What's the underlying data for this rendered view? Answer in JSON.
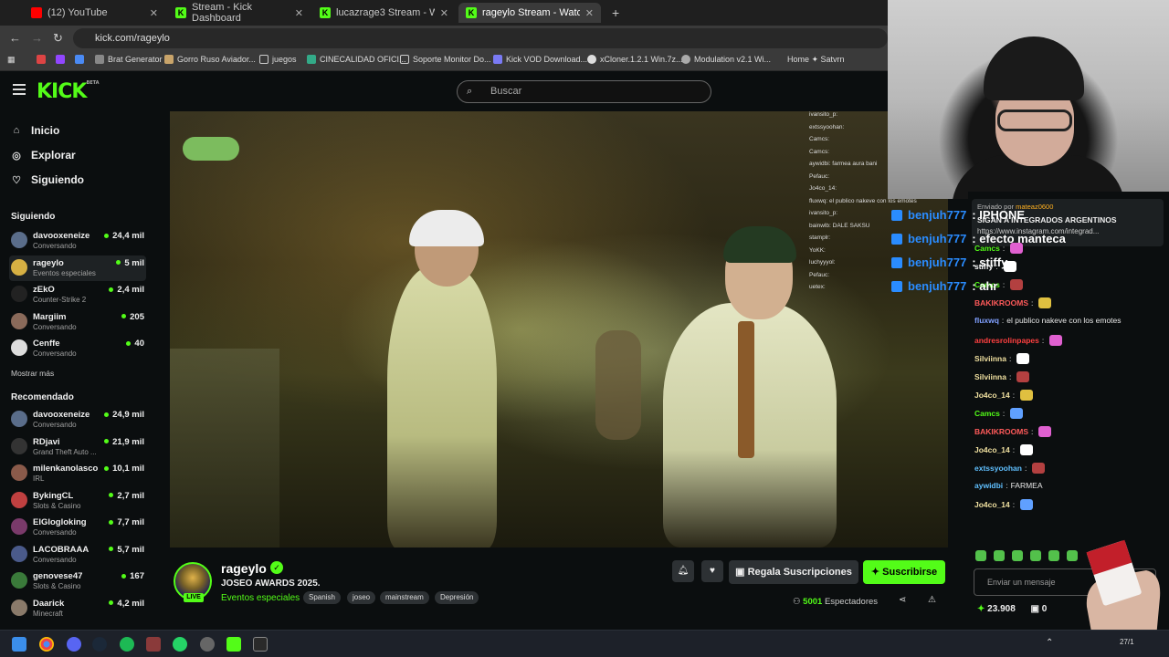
{
  "browser": {
    "tabs": [
      {
        "label": "(12) YouTube",
        "color": "#ff0000",
        "active": false
      },
      {
        "label": "Stream - Kick Dashboard",
        "color": "#53fc18",
        "active": false
      },
      {
        "label": "lucazrage3 Stream - Watch Live",
        "color": "#53fc18",
        "active": false
      },
      {
        "label": "rageylo Stream - Watch Live",
        "color": "#53fc18",
        "active": true
      }
    ],
    "url": "kick.com/rageylo",
    "bookmarks": [
      "Brat Generator",
      "Gorro Ruso Aviador...",
      "juegos",
      "CINECALIDAD OFICI...",
      "Soporte Monitor Do...",
      "Kick VOD Download...",
      "xCloner.1.2.1 Win.7z...",
      "Modulation v2.1 Wi...",
      "Home ✦ Satvrn"
    ]
  },
  "header": {
    "logo": "KICK",
    "logo_sup": "BETA",
    "search_placeholder": "Buscar"
  },
  "sidebar": {
    "nav": [
      {
        "label": "Inicio",
        "icon": "home-icon",
        "glyph": "⌂"
      },
      {
        "label": "Explorar",
        "icon": "compass-icon",
        "glyph": "◎"
      },
      {
        "label": "Siguiendo",
        "icon": "heart-icon",
        "glyph": "♡"
      }
    ],
    "following_title": "Siguiendo",
    "following": [
      {
        "name": "davooxeneize",
        "category": "Conversando",
        "viewers": "24,4 mil",
        "color": "#5a6d8a"
      },
      {
        "name": "rageylo",
        "category": "Eventos especiales",
        "viewers": "5 mil",
        "color": "#d6b043"
      },
      {
        "name": "zEkO",
        "category": "Counter-Strike 2",
        "viewers": "2,4 mil",
        "color": "#222222"
      },
      {
        "name": "Margiim",
        "category": "Conversando",
        "viewers": "205",
        "color": "#8a6a5a"
      },
      {
        "name": "Cenffe",
        "category": "Conversando",
        "viewers": "40",
        "color": "#dddddd"
      }
    ],
    "show_more": "Mostrar más",
    "recommended_title": "Recomendado",
    "recommended": [
      {
        "name": "davooxeneize",
        "category": "Conversando",
        "viewers": "24,9 mil",
        "color": "#5a6d8a"
      },
      {
        "name": "RDjavi",
        "category": "Grand Theft Auto ...",
        "viewers": "21,9 mil",
        "color": "#333333"
      },
      {
        "name": "milenkanolasco",
        "category": "IRL",
        "viewers": "10,1 mil",
        "color": "#8a5a4a"
      },
      {
        "name": "BykingCL",
        "category": "Slots & Casino",
        "viewers": "2,7 mil",
        "color": "#c04040"
      },
      {
        "name": "ElGlogloking",
        "category": "Conversando",
        "viewers": "7,7 mil",
        "color": "#7a3a6a"
      },
      {
        "name": "LACOBRAAA",
        "category": "Conversando",
        "viewers": "5,7 mil",
        "color": "#4a5a8a"
      },
      {
        "name": "genovese47",
        "category": "Slots & Casino",
        "viewers": "167",
        "color": "#3a7a3a"
      },
      {
        "name": "Daarick",
        "category": "Minecraft",
        "viewers": "4,2 mil",
        "color": "#8a7a6a"
      }
    ]
  },
  "stream": {
    "name": "rageylo",
    "title": "JOSEO AWARDS 2025.",
    "category": "Eventos especiales",
    "tags": [
      "Spanish",
      "joseo",
      "mainstream",
      "Depresión"
    ],
    "live": "LIVE",
    "gift_label": "Regala Suscripciones",
    "subscribe_label": "Suscribirse",
    "viewers": "5001",
    "viewers_label": "Espectadores"
  },
  "overlay_alerts": [
    {
      "user": "benjuh777",
      "text": ": IPHONE"
    },
    {
      "user": "benjuh777",
      "text": ": efecto manteca"
    },
    {
      "user": "benjuh777",
      "text": ": stiffy"
    },
    {
      "user": "benjuh777",
      "text": ": ahr"
    }
  ],
  "video_chat": [
    "ivansito_p:",
    "extssyoohan:",
    "Camcs:",
    "Camcs:",
    "aywidbi: farmea aura bani",
    "Pefauc:",
    "Jo4co_14:",
    "fluxwq: el publico nakeve con los emotes",
    "ivansito_p:",
    "bainwlb: DALE SAKSU",
    "stamplr:",
    "YoKK:",
    "luchyyyol:",
    "Pefauc:",
    "uetex:"
  ],
  "chat": {
    "pinned_by": "Enviado por",
    "pinned_user": "mateaz0600",
    "pinned_text1": "SIGAN A INTEGRADOS ARGENTINOS",
    "pinned_text2": "https://www.instagram.com/integrad...",
    "messages": [
      {
        "user": "Camcs",
        "text": "",
        "color": "#53fc18"
      },
      {
        "user": "stiffy",
        "text": "",
        "color": "#ffffff"
      },
      {
        "user": "Camcs",
        "text": "",
        "color": "#53fc18"
      },
      {
        "user": "BAKIKROOMS",
        "text": "",
        "color": "#ff5a5a"
      },
      {
        "user": "fluxwq",
        "text": "el publico nakeve con los emotes",
        "color": "#80a0ff"
      },
      {
        "user": "andresrolinpapes",
        "text": "",
        "color": "#ff4040"
      },
      {
        "user": "Silviinna",
        "text": "",
        "color": "#f0e0a0"
      },
      {
        "user": "Silviinna",
        "text": "",
        "color": "#f0e0a0"
      },
      {
        "user": "Jo4co_14",
        "text": "",
        "color": "#f0e0a0"
      },
      {
        "user": "Camcs",
        "text": "",
        "color": "#53fc18"
      },
      {
        "user": "BAKIKROOMS",
        "text": "",
        "color": "#ff5a5a"
      },
      {
        "user": "Jo4co_14",
        "text": "",
        "color": "#f0e0a0"
      },
      {
        "user": "extssyoohan",
        "text": "",
        "color": "#60c0ff"
      },
      {
        "user": "aywidbi",
        "text": "FARMEA",
        "color": "#60c0ff"
      },
      {
        "user": "Jo4co_14",
        "text": "",
        "color": "#f0e0a0"
      }
    ],
    "input_placeholder": "Enviar un mensaje",
    "points": "23.908",
    "count": "0"
  },
  "taskbar": {
    "date": "27/1"
  }
}
